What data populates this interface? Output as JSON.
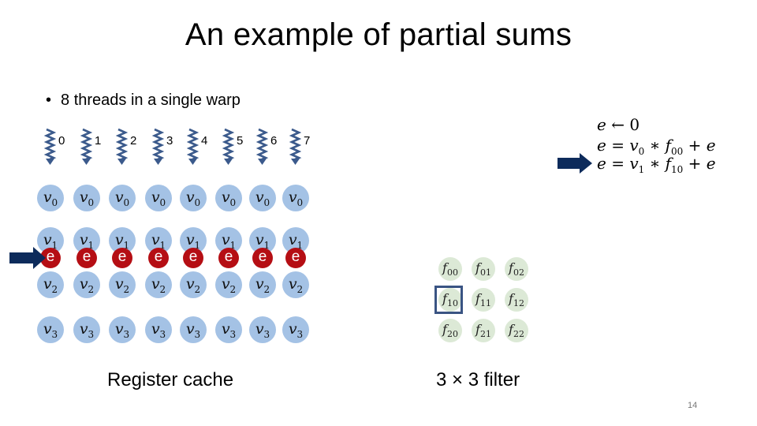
{
  "slide": {
    "title": "An example of partial sums",
    "bullet": "8 threads in a single warp",
    "page_number": "14"
  },
  "threads": [
    "0",
    "1",
    "2",
    "3",
    "4",
    "5",
    "6",
    "7"
  ],
  "register_cache": {
    "label": "Register cache",
    "rows": [
      {
        "var": "v",
        "sub": "0"
      },
      {
        "var": "v",
        "sub": "1"
      },
      {
        "var": "v",
        "sub": "2"
      },
      {
        "var": "v",
        "sub": "3"
      }
    ],
    "accumulator_label": "e",
    "accumulator_color": "#b50e14",
    "register_color": "#a4c2e5"
  },
  "filter": {
    "label": "3 × 3 filter",
    "cells": [
      [
        "00",
        "01",
        "02"
      ],
      [
        "10",
        "11",
        "12"
      ],
      [
        "20",
        "21",
        "22"
      ]
    ],
    "highlighted": "10",
    "highlight_color": "#3a5483"
  },
  "equations": [
    {
      "lhs": "e",
      "op": "←",
      "rhs": "0"
    },
    {
      "lhs": "e",
      "op": "=",
      "rhs_v": "0",
      "rhs_f": "00",
      "plus": "e"
    },
    {
      "lhs": "e",
      "op": "=",
      "rhs_v": "1",
      "rhs_f": "10",
      "plus": "e"
    }
  ],
  "current_step": 2,
  "arrow_color": "#0d2b5b"
}
